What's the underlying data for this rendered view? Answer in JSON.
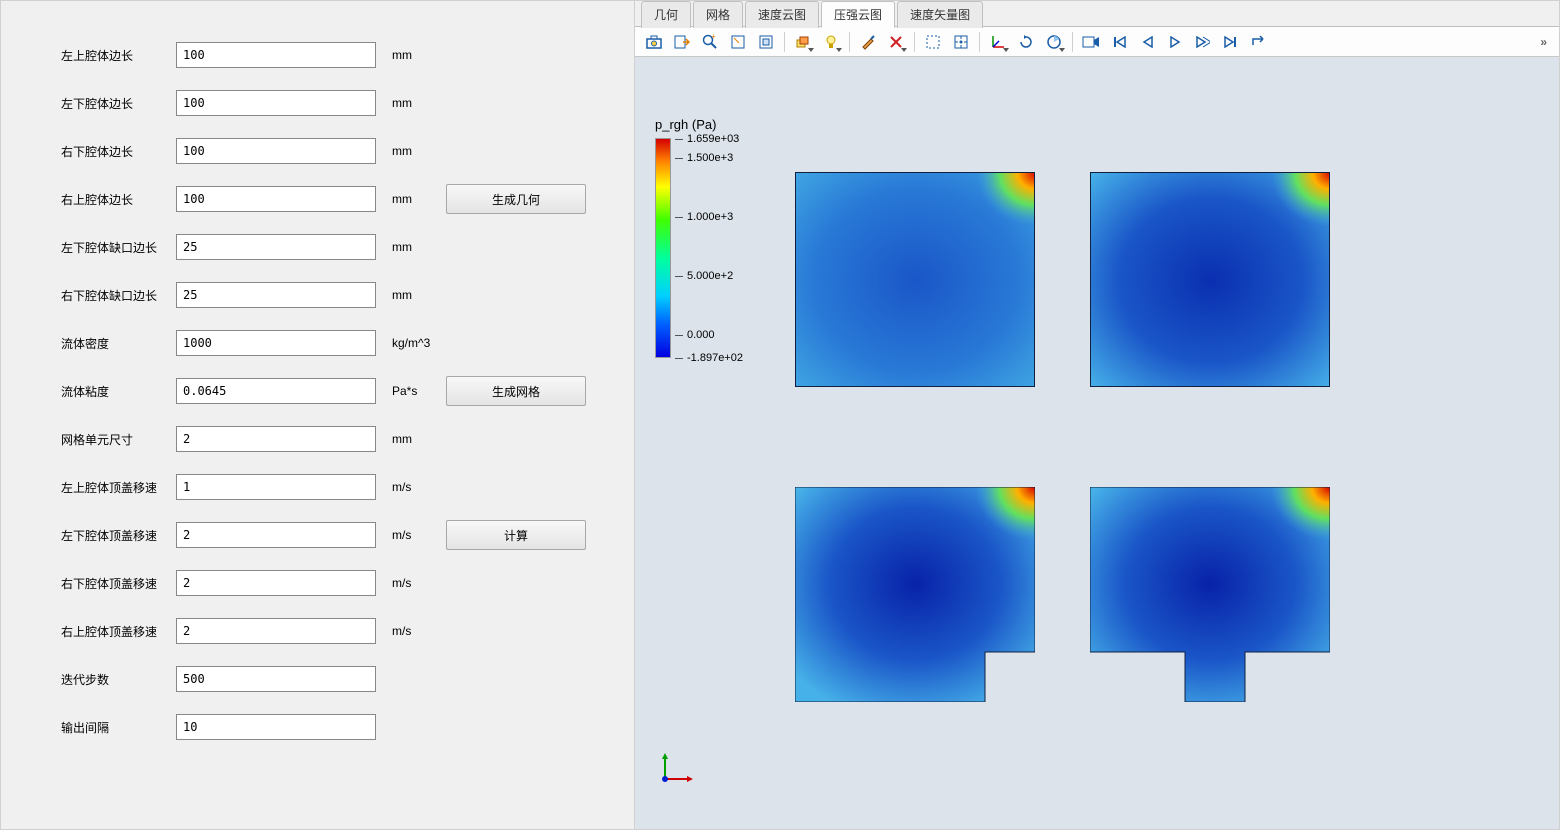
{
  "form": {
    "rows": [
      {
        "label": "左上腔体边长",
        "value": "100",
        "unit": "mm"
      },
      {
        "label": "左下腔体边长",
        "value": "100",
        "unit": "mm"
      },
      {
        "label": "右下腔体边长",
        "value": "100",
        "unit": "mm"
      },
      {
        "label": "右上腔体边长",
        "value": "100",
        "unit": "mm",
        "button": "生成几何"
      },
      {
        "label": "左下腔体缺口边长",
        "value": "25",
        "unit": "mm"
      },
      {
        "label": "右下腔体缺口边长",
        "value": "25",
        "unit": "mm"
      },
      {
        "label": "流体密度",
        "value": "1000",
        "unit": "kg/m^3"
      },
      {
        "label": "流体粘度",
        "value": "0.0645",
        "unit": "Pa*s",
        "button": "生成网格"
      },
      {
        "label": "网格单元尺寸",
        "value": "2",
        "unit": "mm"
      },
      {
        "label": "左上腔体顶盖移速",
        "value": "1",
        "unit": "m/s"
      },
      {
        "label": "左下腔体顶盖移速",
        "value": "2",
        "unit": "m/s",
        "button": "计算"
      },
      {
        "label": "右下腔体顶盖移速",
        "value": "2",
        "unit": "m/s"
      },
      {
        "label": "右上腔体顶盖移速",
        "value": "2",
        "unit": "m/s"
      },
      {
        "label": "迭代步数",
        "value": "500",
        "unit": ""
      },
      {
        "label": "输出间隔",
        "value": "10",
        "unit": ""
      }
    ]
  },
  "tabs": {
    "items": [
      "几何",
      "网格",
      "速度云图",
      "压强云图",
      "速度矢量图"
    ],
    "active_index": 3
  },
  "colorbar": {
    "title": "p_rgh (Pa)",
    "max": "1.659e+03",
    "ticks": [
      "1.500e+3",
      "1.000e+3",
      "5.000e+2",
      "0.000"
    ],
    "min": "-1.897e+02"
  },
  "toolbar_overflow": "»",
  "chart_data": {
    "type": "heatmap",
    "title": "p_rgh (Pa)",
    "variable": "p_rgh",
    "unit": "Pa",
    "range": {
      "min": -189.7,
      "max": 1659
    },
    "colorbar_ticks": [
      -189.7,
      0,
      500,
      1000,
      1500,
      1659
    ],
    "panels": [
      {
        "name": "左上腔体",
        "lid_speed_m_s": 1,
        "side_mm": 100,
        "notch_mm": 0,
        "approx_pressure_Pa": {
          "interior": 50,
          "top_right_corner": 1650
        }
      },
      {
        "name": "右上腔体",
        "lid_speed_m_s": 2,
        "side_mm": 100,
        "notch_mm": 0,
        "approx_pressure_Pa": {
          "interior": -100,
          "top_right_corner": 1650
        }
      },
      {
        "name": "左下腔体",
        "lid_speed_m_s": 2,
        "side_mm": 100,
        "notch_mm": 25,
        "notch_side": "right",
        "approx_pressure_Pa": {
          "interior": -150,
          "top_right_corner": 1650
        }
      },
      {
        "name": "右下腔体",
        "lid_speed_m_s": 2,
        "side_mm": 100,
        "notch_mm": 25,
        "notch_side": "center",
        "approx_pressure_Pa": {
          "interior": -150,
          "top_right_corner": 1650
        }
      }
    ]
  }
}
